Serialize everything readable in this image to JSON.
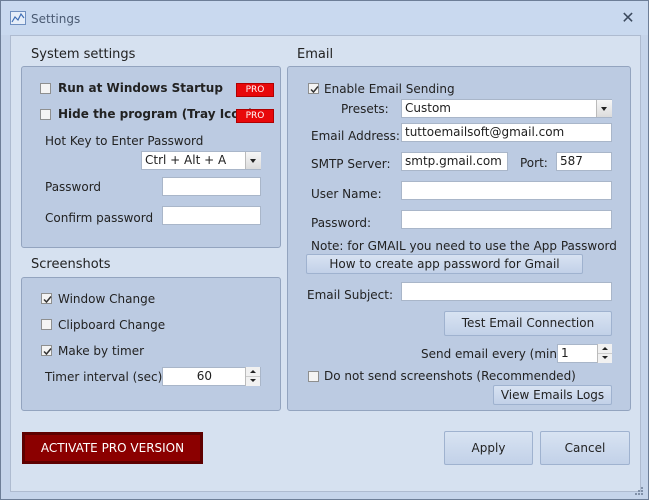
{
  "window": {
    "title": "Settings",
    "close_glyph": "✕"
  },
  "system_settings": {
    "title": "System settings",
    "run_at_startup": {
      "label": "Run at Windows Startup",
      "checked": false,
      "badge": "PRO"
    },
    "hide_program": {
      "label": "Hide the program (Tray Icon)",
      "checked": false,
      "badge": "PRO"
    },
    "hotkey_label": "Hot Key to Enter Password",
    "hotkey_value": "Ctrl + Alt + A",
    "password_label": "Password",
    "password_value": "",
    "confirm_label": "Confirm password",
    "confirm_value": ""
  },
  "screenshots": {
    "title": "Screenshots",
    "window_change": {
      "label": "Window Change",
      "checked": true
    },
    "clipboard_change": {
      "label": "Clipboard Change",
      "checked": false
    },
    "make_by_timer": {
      "label": "Make by timer",
      "checked": true
    },
    "timer_label": "Timer interval (sec)",
    "timer_value": "60"
  },
  "email": {
    "title": "Email",
    "enable": {
      "label": "Enable Email Sending",
      "checked": true
    },
    "presets_label": "Presets:",
    "presets_value": "Custom",
    "address_label": "Email Address:",
    "address_value": "tuttoemailsoft@gmail.com",
    "smtp_label": "SMTP Server:",
    "smtp_value": "smtp.gmail.com",
    "port_label": "Port:",
    "port_value": "587",
    "username_label": "User Name:",
    "username_value": "",
    "password_label": "Password:",
    "password_value": "",
    "note": "Note: for GMAIL you need to use the App Password",
    "how_to_button": "How to create app password for Gmail",
    "subject_label": "Email Subject:",
    "subject_value": "",
    "test_button": "Test Email Connection",
    "send_every_label": "Send email every (min)",
    "send_every_value": "1",
    "no_screenshots": {
      "label": "Do not send screenshots (Recommended)",
      "checked": false
    },
    "logs_button": "View Emails Logs"
  },
  "footer": {
    "activate_button": "ACTIVATE PRO VERSION",
    "apply_button": "Apply",
    "cancel_button": "Cancel"
  },
  "colors": {
    "pro_badge": "#e8080a",
    "activate": "#8b0000",
    "panel": "#bccbe2",
    "background": "#d6e1f0"
  },
  "icons": {
    "app": "chart-icon",
    "checkbox_checked": "check-icon"
  }
}
